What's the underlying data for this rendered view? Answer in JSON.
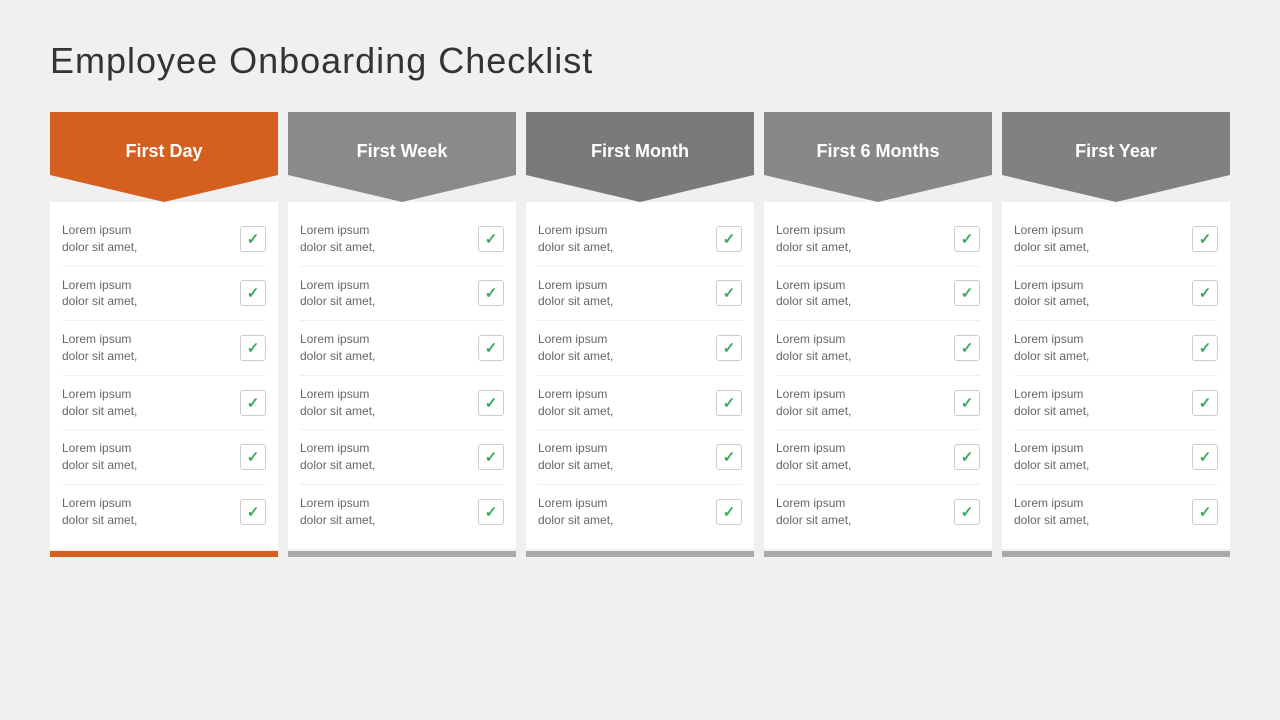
{
  "title": "Employee  Onboarding Checklist",
  "columns": [
    {
      "id": "first-day",
      "label": "First Day",
      "color": "orange",
      "items": [
        "Lorem ipsum dolor sit amet,",
        "Lorem ipsum dolor sit amet,",
        "Lorem ipsum dolor sit amet,",
        "Lorem ipsum dolor sit amet,",
        "Lorem ipsum dolor sit amet,",
        "Lorem ipsum dolor sit amet,"
      ]
    },
    {
      "id": "first-week",
      "label": "First Week",
      "color": "gray1",
      "items": [
        "Lorem ipsum dolor sit amet,",
        "Lorem ipsum dolor sit amet,",
        "Lorem ipsum dolor sit amet,",
        "Lorem ipsum dolor sit amet,",
        "Lorem ipsum dolor sit amet,",
        "Lorem ipsum dolor sit amet,"
      ]
    },
    {
      "id": "first-month",
      "label": "First Month",
      "color": "gray2",
      "items": [
        "Lorem ipsum dolor sit amet,",
        "Lorem ipsum dolor sit amet,",
        "Lorem ipsum dolor sit amet,",
        "Lorem ipsum dolor sit amet,",
        "Lorem ipsum dolor sit amet,",
        "Lorem ipsum dolor sit amet,"
      ]
    },
    {
      "id": "first-6-months",
      "label": "First 6 Months",
      "color": "gray3",
      "items": [
        "Lorem ipsum dolor sit amet,",
        "Lorem ipsum dolor sit amet,",
        "Lorem ipsum dolor sit amet,",
        "Lorem ipsum dolor sit amet,",
        "Lorem ipsum dolor sit amet,",
        "Lorem ipsum dolor sit amet,"
      ]
    },
    {
      "id": "first-year",
      "label": "First Year",
      "color": "gray4",
      "items": [
        "Lorem ipsum dolor sit amet,",
        "Lorem ipsum dolor sit amet,",
        "Lorem ipsum dolor sit amet,",
        "Lorem ipsum dolor sit amet,",
        "Lorem ipsum dolor sit amet,",
        "Lorem ipsum dolor sit amet,"
      ]
    }
  ],
  "item_line2": "dolor sit amet,"
}
